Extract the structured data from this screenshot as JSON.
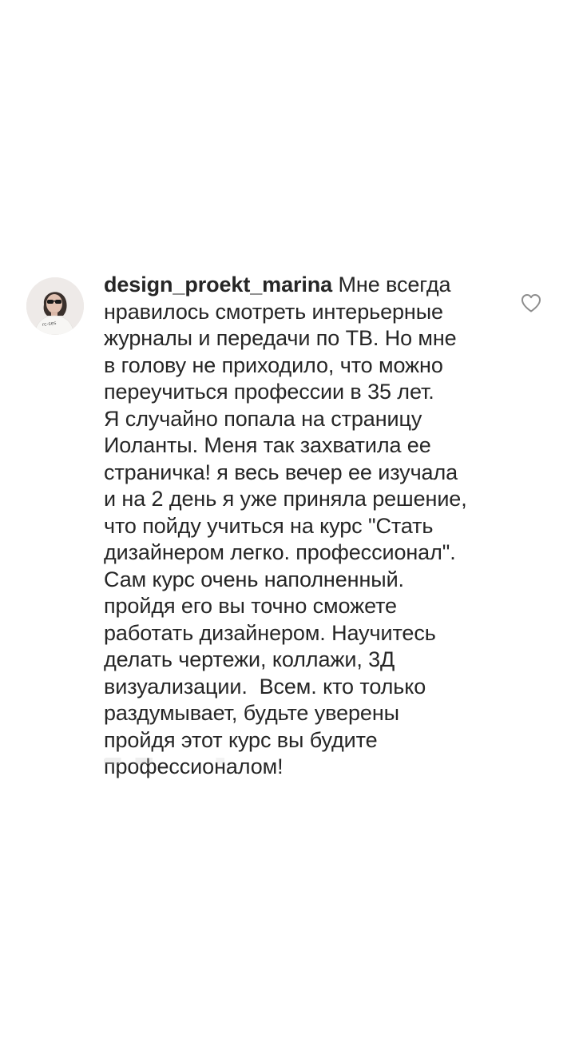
{
  "comment": {
    "username": "design_proekt_marina",
    "avatar_caption": "rc-ses",
    "text_lines": [
      "Мне всегда",
      "нравилось смотреть интерьерные",
      "журналы и передачи по ТВ. Но мне",
      "в голову не приходило, что можно",
      "переучиться профессии в 35 лет.",
      "Я случайно попала на страницу",
      "Иоланты. Меня так захватила ее",
      "страничка! я весь вечер ее изучала",
      "и на 2 день я уже приняла решение,",
      "что пойду учиться на курс \"Стать",
      "дизайнером легко. профессионал\".",
      "Сам курс очень наполненный.",
      "пройдя его вы точно сможете",
      "работать дизайнером. Научитесь",
      "делать чертежи, коллажи, 3Д",
      "визуализации.  Всем. кто только",
      "раздумывает, будьте уверены",
      "пройдя этот курс вы будите",
      "профессионалом!"
    ],
    "like_icon": "heart-outline-icon"
  }
}
